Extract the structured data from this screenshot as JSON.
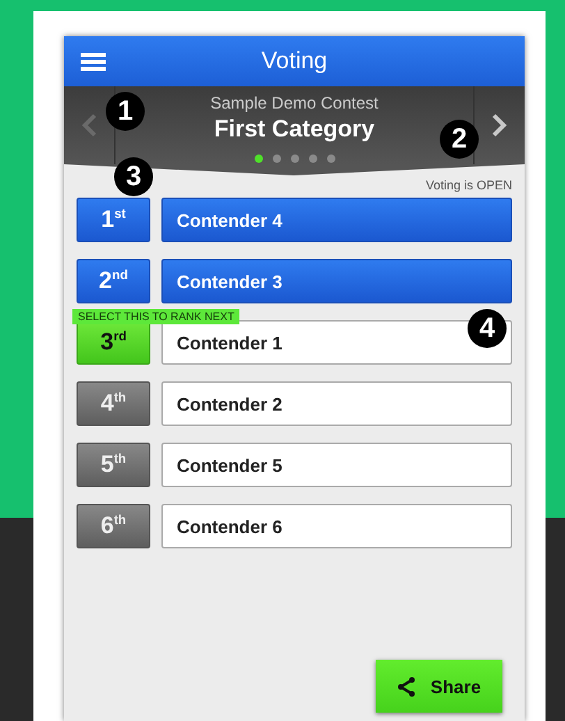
{
  "header": {
    "title": "Voting"
  },
  "contest": {
    "name": "Sample Demo Contest",
    "category": "First Category",
    "previous": {
      "disabled": true
    },
    "next": {
      "disabled": false
    },
    "pages": [
      {
        "selected": true
      },
      {
        "selected": false
      },
      {
        "selected": false
      },
      {
        "selected": false
      },
      {
        "selected": false
      }
    ]
  },
  "status": "Voting is OPEN",
  "rows": [
    {
      "rank": "1$^{st}$",
      "contender": "Contender 4",
      "kind": "ranked"
    },
    {
      "rank": "2$^{nd}$",
      "contender": "Contender 3",
      "kind": "ranked"
    },
    {
      "rank": "3$^{rd}$",
      "contender": "Contender 1",
      "kind": "next",
      "hint": "SELECT THIS TO RANK NEXT"
    },
    {
      "rank": "4$^{th}$",
      "contender": "Contender 2",
      "kind": "unranked"
    },
    {
      "rank": "5$^{th}$",
      "contender": "Contender 5",
      "kind": "unranked"
    },
    {
      "rank": "6$^{th}$",
      "contender": "Contender 6",
      "kind": "unranked"
    }
  ],
  "share_button": {
    "label": "Share"
  },
  "callouts": [
    "1",
    "2",
    "3",
    "4"
  ]
}
